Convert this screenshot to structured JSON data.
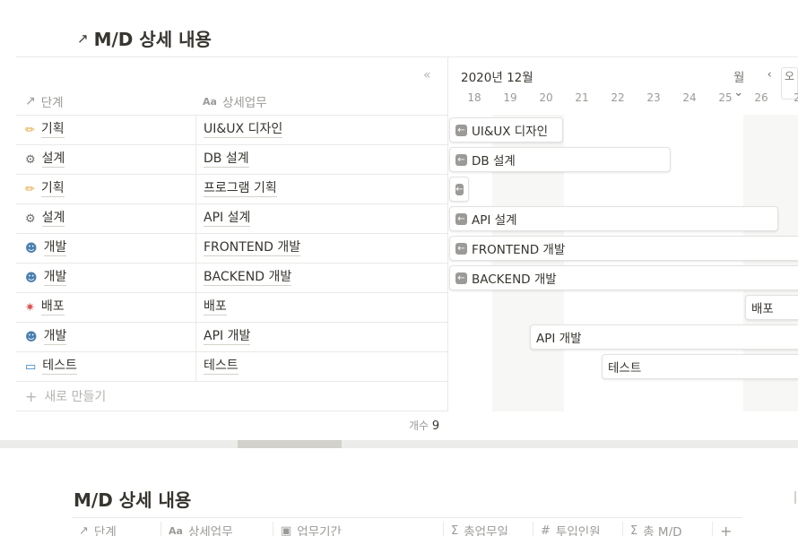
{
  "view": {
    "title": "M/D 상세 내용",
    "collapse_glyph": "«",
    "columns": {
      "phase": "단계",
      "task": "상세업무"
    },
    "rows": [
      {
        "phase": "기획",
        "phase_icon": "pencil-icon",
        "task": "UI&UX 디자인"
      },
      {
        "phase": "설계",
        "phase_icon": "gear-icon",
        "task": "DB 설계"
      },
      {
        "phase": "기획",
        "phase_icon": "pencil-icon",
        "task": "프로그램 기획"
      },
      {
        "phase": "설계",
        "phase_icon": "gear-icon",
        "task": "API 설계"
      },
      {
        "phase": "개발",
        "phase_icon": "developer-icon",
        "task": "FRONTEND 개발"
      },
      {
        "phase": "개발",
        "phase_icon": "developer-icon",
        "task": "BACKEND 개발"
      },
      {
        "phase": "배포",
        "phase_icon": "party-popper-icon",
        "task": "배포"
      },
      {
        "phase": "개발",
        "phase_icon": "developer-icon",
        "task": "API 개발"
      },
      {
        "phase": "테스트",
        "phase_icon": "computer-icon",
        "task": "테스트"
      }
    ],
    "new_row_label": "새로 만들기",
    "count_label": "개수",
    "count_value": "9"
  },
  "timeline": {
    "month": "2020년 12월",
    "scale_label": "월",
    "days": [
      "18",
      "19",
      "20",
      "21",
      "22",
      "23",
      "24",
      "25",
      "26",
      "2"
    ],
    "bars": [
      {
        "label": "UI&UX 디자인",
        "row": 0,
        "arrow": true
      },
      {
        "label": "DB 설계",
        "row": 1,
        "arrow": true
      },
      {
        "label": "",
        "row": 2,
        "arrow": true
      },
      {
        "label": "API 설계",
        "row": 3,
        "arrow": true
      },
      {
        "label": "FRONTEND 개발",
        "row": 4,
        "arrow": true
      },
      {
        "label": "BACKEND 개발",
        "row": 5,
        "arrow": true
      },
      {
        "label": "배포",
        "row": 6,
        "arrow": false
      },
      {
        "label": "API 개발",
        "row": 7,
        "arrow": false
      },
      {
        "label": "테스트",
        "row": 8,
        "arrow": false
      }
    ]
  },
  "second_view": {
    "title": "M/D 상세 내용",
    "columns": [
      "단계",
      "상세업무",
      "업무기간",
      "총업무일",
      "투입인원",
      "총 M/D"
    ],
    "column_icons": [
      "arrow-icon",
      "text-icon",
      "calendar-icon",
      "sigma-icon",
      "number-icon",
      "sigma-icon"
    ],
    "add_column": "+"
  },
  "colors": {
    "text": "#37352f",
    "muted": "#9b9a97",
    "border": "#e9e9e7",
    "weekend": "#f7f7f5"
  }
}
